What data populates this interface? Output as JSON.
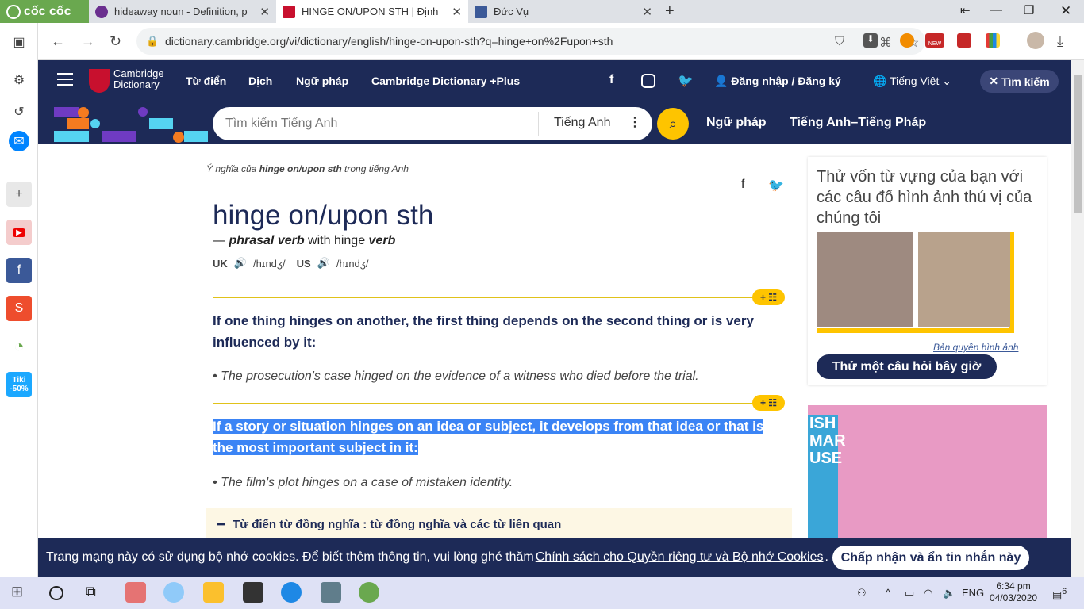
{
  "browser": {
    "brand": "cốc cốc",
    "tabs": [
      {
        "title": "hideaway noun - Definition, p"
      },
      {
        "title": "HINGE ON/UPON STH | Định"
      },
      {
        "title": "Đức Vụ"
      }
    ],
    "url": "dictionary.cambridge.org/vi/dictionary/english/hinge-on-upon-sth?q=hinge+on%2Fupon+sth",
    "ext_badge": "NEW"
  },
  "site": {
    "logo_line1": "Cambridge",
    "logo_line2": "Dictionary",
    "menu": [
      "Từ điển",
      "Dịch",
      "Ngữ pháp",
      "Cambridge Dictionary +Plus"
    ],
    "login": "Đăng nhập / Đăng ký",
    "language": "Tiếng Việt",
    "search_btn": "Tìm kiếm",
    "search_placeholder": "Tìm kiếm Tiếng Anh",
    "search_lang": "Tiếng Anh",
    "band_links": [
      "Ngữ pháp",
      "Tiếng Anh–Tiếng Pháp"
    ]
  },
  "entry": {
    "crumb_prefix": "Ý nghĩa của ",
    "crumb_word": "hinge on/upon sth",
    "crumb_suffix": " trong tiếng Anh",
    "headword": "hinge on/upon sth",
    "pos_dash": "— ",
    "pos": "phrasal verb",
    "pos_with": " with hinge ",
    "pos_verb": "verb",
    "uk_label": "UK",
    "uk_ipa": "/hɪndʒ/",
    "us_label": "US",
    "us_ipa": "/hɪndʒ/",
    "pill": "+ ☷",
    "senses": [
      {
        "definition": "If one thing hinges on another, the first thing depends on the second thing or is very influenced by it:",
        "example": "The prosecution's case hinged on the evidence of a witness who died before the trial."
      },
      {
        "definition": "If a story or situation hinges on an idea or subject, it develops from that idea or that is the most important subject in it:",
        "example": "The film's plot hinges on a case of mistaken identity."
      }
    ],
    "bullet": "•",
    "synonyms": "Từ điển từ đồng nghĩa : từ đồng nghĩa và các từ liên quan"
  },
  "promo": {
    "title": "Thử vốn từ vựng của bạn với các câu đố hình ảnh thú vị của chúng tôi",
    "copyright": "Bản quyền hình ảnh",
    "button": "Thử một câu hỏi bây giờ"
  },
  "ad": {
    "book_text": "ISH MAR USE"
  },
  "cookie": {
    "text": "Trang mạng này có sử dụng bộ nhớ cookies. Để biết thêm thông tin, vui lòng ghé thăm",
    "link": "Chính sách cho Quyền riêng tư và Bộ nhớ Cookies",
    "period": ".",
    "button": "Chấp nhận và ẩn tin nhắn này"
  },
  "taskbar": {
    "lang": "ENG",
    "time": "6:34 pm",
    "date": "04/03/2020",
    "notif": "6",
    "tiki": "Tiki -50%"
  },
  "colors": {
    "navy": "#1d2a57",
    "yellow": "#fec400",
    "highlight": "#3b84f5",
    "coccoc_green": "#6aa84f"
  }
}
